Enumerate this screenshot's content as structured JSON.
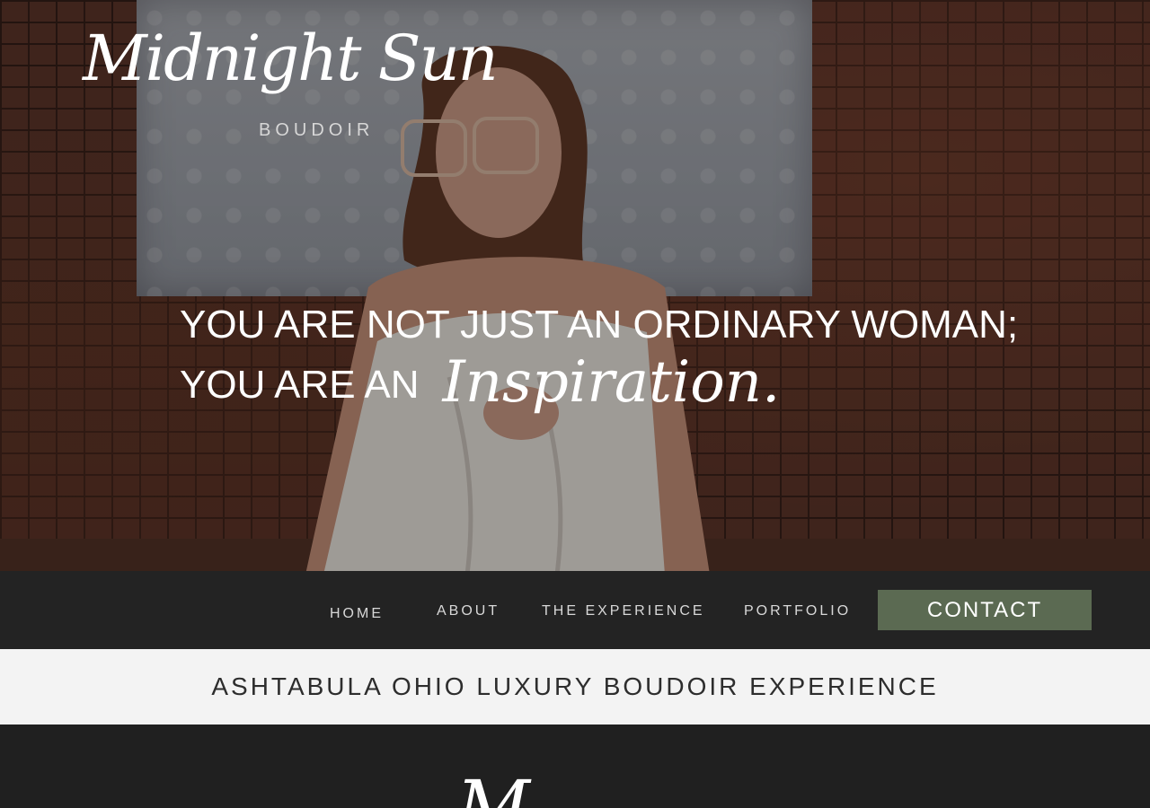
{
  "brand": {
    "name": "Midnight Sun",
    "subtitle": "BOUDOIR"
  },
  "hero": {
    "line1": "YOU ARE NOT JUST AN ORDINARY WOMAN;",
    "line2_prefix": "YOU ARE AN",
    "line2_script": "Inspiration."
  },
  "nav": {
    "items": [
      {
        "label": "HOME"
      },
      {
        "label": "ABOUT"
      },
      {
        "label": "THE EXPERIENCE"
      },
      {
        "label": "PORTFOLIO"
      }
    ],
    "contact_label": "CONTACT"
  },
  "banner": {
    "text": "ASHTABULA OHIO LUXURY BOUDOIR EXPERIENCE"
  },
  "lower": {
    "script_fragment": "M"
  },
  "colors": {
    "nav_bg": "#232323",
    "contact_bg": "#5b6a52",
    "banner_bg": "#f3f3f3",
    "banner_text": "#2d2d2d",
    "page_bg": "#202020"
  }
}
